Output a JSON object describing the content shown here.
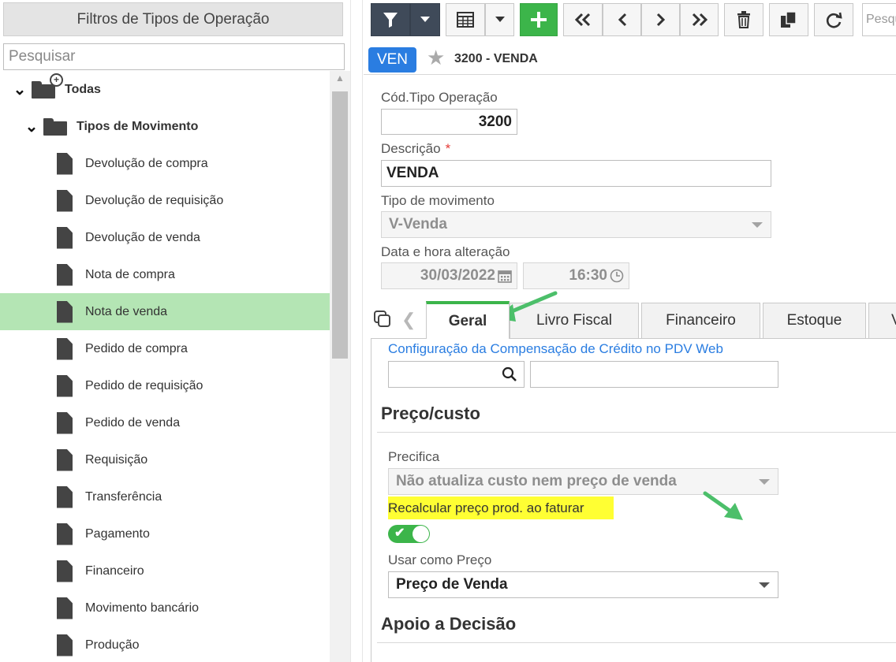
{
  "left_panel": {
    "header": "Filtros de Tipos de Operação",
    "search_placeholder": "Pesquisar",
    "tree": {
      "root": "Todas",
      "category": "Tipos de Movimento",
      "items": [
        "Devolução de compra",
        "Devolução de requisição",
        "Devolução de venda",
        "Nota de compra",
        "Nota de venda",
        "Pedido de compra",
        "Pedido de requisição",
        "Pedido de venda",
        "Requisição",
        "Transferência",
        "Pagamento",
        "Financeiro",
        "Movimento bancário",
        "Produção"
      ],
      "selected": "Nota de venda"
    }
  },
  "toolbar": {
    "search_placeholder": "Pesquisar"
  },
  "record": {
    "badge": "VEN",
    "title": "3200 - VENDA"
  },
  "form": {
    "cod_label": "Cód.Tipo Operação",
    "cod_value": "3200",
    "descricao_label": "Descrição",
    "required_mark": "*",
    "descricao_value": "VENDA",
    "tipo_mov_label": "Tipo de movimento",
    "tipo_mov_value": "V-Venda",
    "data_label": "Data e hora alteração",
    "date_value": "30/03/2022",
    "time_value": "16:30"
  },
  "tabs": [
    "Geral",
    "Livro Fiscal",
    "Financeiro",
    "Estoque",
    "V"
  ],
  "active_tab": "Geral",
  "geral": {
    "compensacao_link": "Configuração da Compensação de Crédito no PDV Web",
    "section_preco": "Preço/custo",
    "precifica_label": "Precifica",
    "precifica_value": "Não atualiza custo nem preço de venda",
    "recalc_label": "Recalcular preço prod. ao faturar",
    "recalc_enabled": true,
    "usar_preco_label": "Usar como Preço",
    "usar_preco_value": "Preço de Venda",
    "section_apoio": "Apoio a Decisão"
  },
  "colors": {
    "accent_green": "#3cb54a",
    "selected_row": "#b4e5b4",
    "badge_blue": "#2a7de1",
    "highlight_yellow": "#ffff33",
    "toolbar_dark": "#3f4a59"
  }
}
